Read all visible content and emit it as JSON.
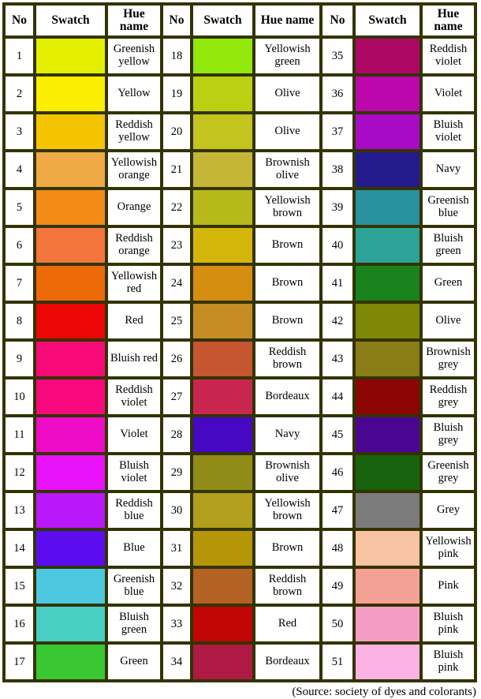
{
  "table": {
    "headers": {
      "no": "No",
      "swatch": "Swatch",
      "hue": "Hue name"
    },
    "caption": "(Source: society of dyes and colorants)",
    "border_color": "#333300",
    "columns": [
      {
        "group": 1,
        "rows": [
          {
            "no": "1",
            "hue": "Greenish yellow",
            "color": "#e4f000"
          },
          {
            "no": "2",
            "hue": "Yellow",
            "color": "#fbee00"
          },
          {
            "no": "3",
            "hue": "Reddish yellow",
            "color": "#f4c400"
          },
          {
            "no": "4",
            "hue": "Yellowish orange",
            "color": "#efa945"
          },
          {
            "no": "5",
            "hue": "Orange",
            "color": "#f28c16"
          },
          {
            "no": "6",
            "hue": "Reddish orange",
            "color": "#f4763c"
          },
          {
            "no": "7",
            "hue": "Yellowish red",
            "color": "#ed6a08"
          },
          {
            "no": "8",
            "hue": "Red",
            "color": "#ec0606"
          },
          {
            "no": "9",
            "hue": "Bluish red",
            "color": "#f70a78"
          },
          {
            "no": "10",
            "hue": "Reddish violet",
            "color": "#f80a7e"
          },
          {
            "no": "11",
            "hue": "Violet",
            "color": "#ef0cc6"
          },
          {
            "no": "12",
            "hue": "Bluish violet",
            "color": "#e712f7"
          },
          {
            "no": "13",
            "hue": "Reddish blue",
            "color": "#ba18fb"
          },
          {
            "no": "14",
            "hue": "Blue",
            "color": "#5c0df0"
          },
          {
            "no": "15",
            "hue": "Greenish blue",
            "color": "#4cc8e0"
          },
          {
            "no": "16",
            "hue": "Bluish green",
            "color": "#48cec2"
          },
          {
            "no": "17",
            "hue": "Green",
            "color": "#3ac832"
          }
        ]
      },
      {
        "group": 2,
        "rows": [
          {
            "no": "18",
            "hue": "Yellowish green",
            "color": "#93e80c"
          },
          {
            "no": "19",
            "hue": "Olive",
            "color": "#bcd013"
          },
          {
            "no": "20",
            "hue": "Olive",
            "color": "#c4c41e"
          },
          {
            "no": "21",
            "hue": "Brownish olive",
            "color": "#c5b638"
          },
          {
            "no": "22",
            "hue": "Yellowish brown",
            "color": "#b7b91b"
          },
          {
            "no": "23",
            "hue": "Brown",
            "color": "#d4b50a"
          },
          {
            "no": "24",
            "hue": "Brown",
            "color": "#d68e10"
          },
          {
            "no": "25",
            "hue": "Brown",
            "color": "#c68d24"
          },
          {
            "no": "26",
            "hue": "Reddish brown",
            "color": "#c65630"
          },
          {
            "no": "27",
            "hue": "Bordeaux",
            "color": "#c9264f"
          },
          {
            "no": "28",
            "hue": "Navy",
            "color": "#4708c4"
          },
          {
            "no": "29",
            "hue": "Brownish olive",
            "color": "#918c18"
          },
          {
            "no": "30",
            "hue": "Yellowish brown",
            "color": "#b0a01b"
          },
          {
            "no": "31",
            "hue": "Brown",
            "color": "#b49608"
          },
          {
            "no": "32",
            "hue": "Reddish brown",
            "color": "#b46223"
          },
          {
            "no": "33",
            "hue": "Red",
            "color": "#c20505"
          },
          {
            "no": "34",
            "hue": "Bordeaux",
            "color": "#ae1a44"
          }
        ]
      },
      {
        "group": 3,
        "rows": [
          {
            "no": "35",
            "hue": "Reddish violet",
            "color": "#ae0865"
          },
          {
            "no": "36",
            "hue": "Violet",
            "color": "#bb07ab"
          },
          {
            "no": "37",
            "hue": "Bluish violet",
            "color": "#a80ac6"
          },
          {
            "no": "38",
            "hue": "Navy",
            "color": "#231a8e"
          },
          {
            "no": "39",
            "hue": "Greenish blue",
            "color": "#2991a0"
          },
          {
            "no": "40",
            "hue": "Bluish green",
            "color": "#2ba396"
          },
          {
            "no": "41",
            "hue": "Green",
            "color": "#19821c"
          },
          {
            "no": "42",
            "hue": "Olive",
            "color": "#7e8706"
          },
          {
            "no": "43",
            "hue": "Brownish grey",
            "color": "#8a7c16"
          },
          {
            "no": "44",
            "hue": "Reddish grey",
            "color": "#8c0606"
          },
          {
            "no": "45",
            "hue": "Bluish grey",
            "color": "#4b0691"
          },
          {
            "no": "46",
            "hue": "Greenish grey",
            "color": "#17620c"
          },
          {
            "no": "47",
            "hue": "Grey",
            "color": "#7b7b7b"
          },
          {
            "no": "48",
            "hue": "Yellowish pink",
            "color": "#f7c3a2"
          },
          {
            "no": "49",
            "hue": "Pink",
            "color": "#f4a195"
          },
          {
            "no": "50",
            "hue": "Bluish pink",
            "color": "#f49cc4"
          },
          {
            "no": "51",
            "hue": "Bluish pink",
            "color": "#fbb2e4"
          }
        ]
      }
    ]
  }
}
